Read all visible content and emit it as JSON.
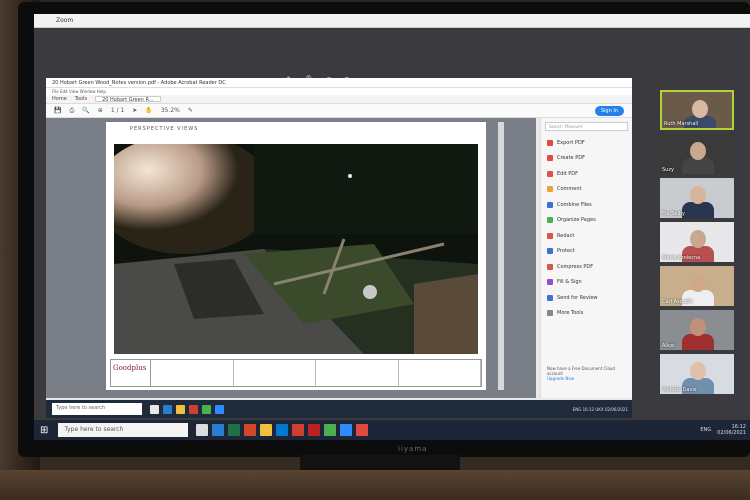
{
  "zoom": {
    "window_title": "Zoom"
  },
  "acrobat": {
    "title": "20 Hobart Green Wood_Notes version.pdf - Adobe Acrobat Reader DC",
    "menu": "File  Edit  View  Window  Help",
    "tabs": [
      "Home",
      "Tools",
      "20 Hobart Green R..."
    ],
    "page_indicator": "1 / 1",
    "zoom_level": "35.2%",
    "sign_in": "Sign In",
    "page_heading": "PERSPECTIVE VIEWS",
    "logo_text": "Goodplus",
    "search_placeholder": "Search 'Measure'",
    "tools": [
      {
        "label": "Export PDF",
        "color": "#e04a3f"
      },
      {
        "label": "Create PDF",
        "color": "#e04a3f"
      },
      {
        "label": "Edit PDF",
        "color": "#d9534f"
      },
      {
        "label": "Comment",
        "color": "#e8a33a"
      },
      {
        "label": "Combine Files",
        "color": "#3b73d1"
      },
      {
        "label": "Organize Pages",
        "color": "#4caf50"
      },
      {
        "label": "Redact",
        "color": "#d9534f"
      },
      {
        "label": "Protect",
        "color": "#3b73d1"
      },
      {
        "label": "Compress PDF",
        "color": "#d9534f"
      },
      {
        "label": "Fill & Sign",
        "color": "#9c4dcc"
      },
      {
        "label": "Send for Review",
        "color": "#3b73d1"
      },
      {
        "label": "More Tools",
        "color": "#888888"
      }
    ],
    "promo": "Now have a Free Document Cloud account",
    "promo_link": "Upgrade Now"
  },
  "inner_taskbar": {
    "search": "Type here to search",
    "tray": "ENG 16:12\nUKX 02/06/2021"
  },
  "participants": [
    {
      "name": "Ruth Marshall",
      "active": true,
      "bg": "#6a5a4a",
      "face": "#d8b8a0",
      "body": "#3a4a6a"
    },
    {
      "name": "Suzy",
      "active": false,
      "bg": "#3a3a3a",
      "face": "#c8a890",
      "body": "#444"
    },
    {
      "name": "Ele Selby",
      "active": false,
      "bg": "#c8ccd0",
      "face": "#d8b49a",
      "body": "#2a3550"
    },
    {
      "name": "Maria Koniecna",
      "active": false,
      "bg": "#e8e8ea",
      "face": "#caa890",
      "body": "#b85050"
    },
    {
      "name": "Carl Asquith",
      "active": false,
      "bg": "#c8ae8c",
      "face": "#d0a888",
      "body": "#eee"
    },
    {
      "name": "Alice",
      "active": false,
      "bg": "#8a8e92",
      "face": "#c09078",
      "body": "#a03030"
    },
    {
      "name": "Victoria Davis",
      "active": false,
      "bg": "#d6dce2",
      "face": "#e0c0a8",
      "body": "#7090b0"
    }
  ],
  "host_taskbar": {
    "search": "Type here to search",
    "tray": "16:12\n02/06/2021",
    "lang": "ENG"
  }
}
